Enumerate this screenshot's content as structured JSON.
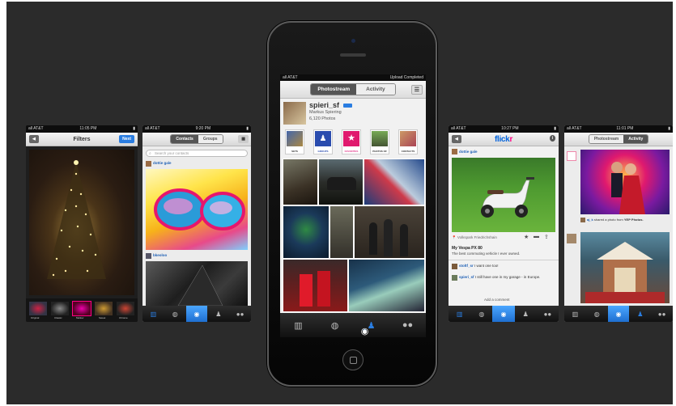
{
  "colors": {
    "stage": "#2b2b2b",
    "accent_blue": "#2a7de1",
    "flickr_pink": "#ff0084",
    "flickr_blue": "#0063dc"
  },
  "filters_screen": {
    "status_carrier": "all AT&T",
    "status_time": "11:05 PM",
    "title": "Filters",
    "next_label": "Next",
    "filters": [
      "Original",
      "Classic",
      "Mellow",
      "Sweet",
      "Chrome"
    ]
  },
  "contacts_screen": {
    "status_carrier": "all AT&T",
    "status_time": "9:20 PM",
    "segments": [
      "Contacts",
      "Groups"
    ],
    "search_placeholder": "Search your contacts",
    "post1_user": "dottie gale",
    "post2_user": "bkeoloo"
  },
  "main_screen": {
    "status_carrier": "all AT&T",
    "status_right": "Upload Completed",
    "segments": [
      "Photostream",
      "Activity"
    ],
    "username": "spieri_sf",
    "realname": "Markus Spiering",
    "count": "6,120 Photos",
    "collections": [
      "SETS",
      "GROUPS",
      "FAVORITES",
      "PHOTOS OF",
      "CONTACTS"
    ]
  },
  "flickr_screen": {
    "status_carrier": "all AT&T",
    "status_time": "10:27 PM",
    "logo_part1": "flick",
    "logo_part2": "r",
    "user": "dottie gale",
    "location": "Volkspark Friedrichshain",
    "photo_title": "My Vespa PX 80",
    "photo_desc": "The best commuting vehicle I ever owned.",
    "comment1_user": "stoltf_sr",
    "comment1_text": "I want one too!",
    "comment2_user": "spieri_sf",
    "comment2_text": "I still have one in my garage - in Europe.",
    "add_comment": "Add a comment"
  },
  "activity_screen": {
    "status_carrier": "all AT&T",
    "status_time": "11:01 PM",
    "segments": [
      "Photostream",
      "Activity"
    ],
    "shared_user": "aj_k",
    "shared_text": "shared a photo from",
    "shared_source": "YEP Photos."
  }
}
